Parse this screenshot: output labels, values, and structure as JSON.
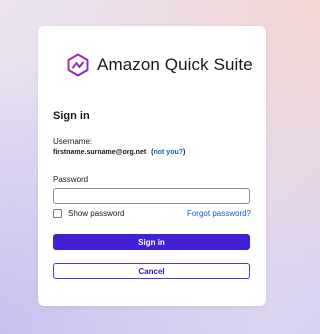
{
  "brand": {
    "name": "Amazon Quick Suite",
    "logo_icon": "amazon-quick-suite-logo-icon"
  },
  "form": {
    "heading": "Sign in",
    "username_label": "Username:",
    "username_value": "firstname.surname@org.net",
    "not_you_open": "(",
    "not_you_link": "not you?",
    "not_you_close": ")",
    "password_label": "Password",
    "password_value": "",
    "show_password_label": "Show password",
    "show_password_checked": false,
    "forgot_password_link": "Forgot password?",
    "sign_in_button": "Sign in",
    "cancel_button": "Cancel"
  },
  "colors": {
    "primary": "#4420d5",
    "link": "#0b5fba",
    "logo_gradient_start": "#b31fa6",
    "logo_gradient_end": "#6a2ce0"
  }
}
